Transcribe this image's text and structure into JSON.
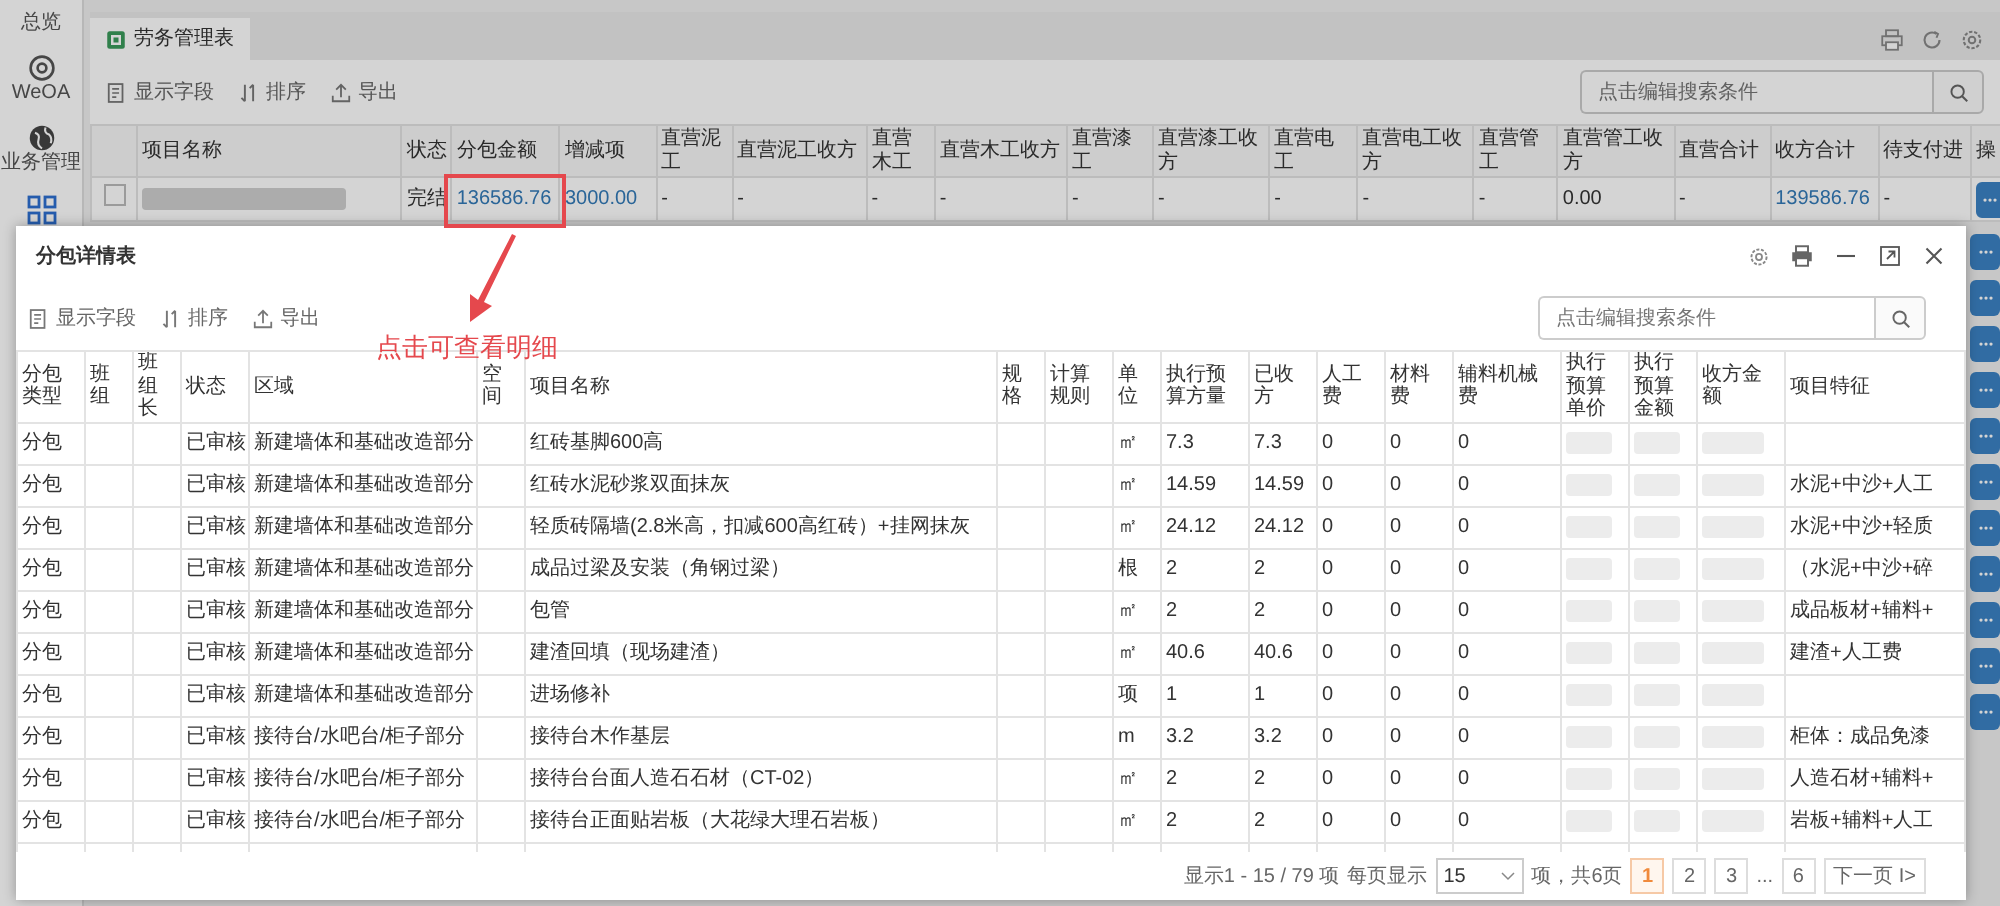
{
  "sidebar": {
    "items": [
      {
        "kind": "overview",
        "label": "总览"
      },
      {
        "kind": "target",
        "label": "WeOA"
      },
      {
        "kind": "globe",
        "label": "业务管理"
      },
      {
        "kind": "grid"
      }
    ]
  },
  "page_tab": {
    "label": "劳务管理表"
  },
  "toolbar": {
    "buttons": [
      {
        "kind": "fields",
        "label": "显示字段"
      },
      {
        "kind": "sort",
        "label": "排序"
      },
      {
        "kind": "export",
        "label": "导出"
      }
    ],
    "search": {
      "placeholder": "点击编辑搜索条件"
    }
  },
  "main_table": {
    "columns": [
      {
        "label": "项目名称",
        "kind": "redacted"
      },
      {
        "label": "状态",
        "kind": "text"
      },
      {
        "label": "分包金额",
        "kind": "link"
      },
      {
        "label": "增减项",
        "kind": "link"
      },
      {
        "label": "直营泥工",
        "kind": "text"
      },
      {
        "label": "直营泥工收方",
        "kind": "text"
      },
      {
        "label": "直营木工",
        "kind": "text"
      },
      {
        "label": "直营木工收方",
        "kind": "text"
      },
      {
        "label": "直营漆工",
        "kind": "text"
      },
      {
        "label": "直营漆工收方",
        "kind": "text"
      },
      {
        "label": "直营电工",
        "kind": "text"
      },
      {
        "label": "直营电工收方",
        "kind": "text"
      },
      {
        "label": "直营管工",
        "kind": "text"
      },
      {
        "label": "直营管工收方",
        "kind": "text"
      },
      {
        "label": "直营合计",
        "kind": "text"
      },
      {
        "label": "收方合计",
        "kind": "link"
      },
      {
        "label": "待支付进",
        "kind": "text"
      },
      {
        "label": "操",
        "kind": "action"
      }
    ],
    "rows": [
      {
        "checked": false,
        "values": [
          "完结",
          "136586.76",
          "3000.00",
          "-",
          "-",
          "-",
          "-",
          "-",
          "-",
          "-",
          "-",
          "-",
          "0.00",
          "-",
          "139586.76",
          "-"
        ]
      }
    ],
    "hidden_row_actions": [
      {
        "kind": "more"
      },
      {
        "kind": "more"
      },
      {
        "kind": "more"
      },
      {
        "kind": "more"
      },
      {
        "kind": "more"
      },
      {
        "kind": "more"
      },
      {
        "kind": "more"
      },
      {
        "kind": "more"
      },
      {
        "kind": "more"
      },
      {
        "kind": "more"
      },
      {
        "kind": "more"
      }
    ]
  },
  "annotation": {
    "text": "点击可查看明细"
  },
  "dialog": {
    "title": "分包详情表",
    "toolbar": {
      "buttons": [
        {
          "kind": "fields",
          "label": "显示字段"
        },
        {
          "kind": "sort",
          "label": "排序"
        },
        {
          "kind": "export",
          "label": "导出"
        }
      ],
      "search": {
        "placeholder": "点击编辑搜索条件"
      }
    },
    "columns": [
      "分包类型",
      "班组",
      "班组长",
      "状态",
      "区域",
      "空间",
      "项目名称",
      "规格",
      "计算规则",
      "单位",
      "执行预算方量",
      "已收方",
      "人工费",
      "材料费",
      "辅料机械费",
      "执行预算单价",
      "执行预算金额",
      "收方金额",
      "项目特征"
    ],
    "rows": [
      {
        "type": "分包",
        "status": "已审核",
        "area": "新建墙体和基础改造部分",
        "item_name": "红砖基脚600高",
        "unit": "㎡",
        "budget_quantity": "7.3",
        "received_quantity": "7.3",
        "labor_cost": "0",
        "material_cost": "0",
        "aux_machine_cost": "0"
      },
      {
        "type": "分包",
        "status": "已审核",
        "area": "新建墙体和基础改造部分",
        "item_name": "红砖水泥砂浆双面抹灰",
        "unit": "㎡",
        "budget_quantity": "14.59",
        "received_quantity": "14.59",
        "labor_cost": "0",
        "material_cost": "0",
        "aux_machine_cost": "0",
        "item_feature": "水泥+中沙+人工"
      },
      {
        "type": "分包",
        "status": "已审核",
        "area": "新建墙体和基础改造部分",
        "item_name": "轻质砖隔墙(2.8米高，扣减600高红砖）+挂网抹灰",
        "unit": "㎡",
        "budget_quantity": "24.12",
        "received_quantity": "24.12",
        "labor_cost": "0",
        "material_cost": "0",
        "aux_machine_cost": "0",
        "item_feature": "水泥+中沙+轻质"
      },
      {
        "type": "分包",
        "status": "已审核",
        "area": "新建墙体和基础改造部分",
        "item_name": "成品过梁及安装（角钢过梁）",
        "unit": "根",
        "budget_quantity": "2",
        "received_quantity": "2",
        "labor_cost": "0",
        "material_cost": "0",
        "aux_machine_cost": "0",
        "item_feature": "（水泥+中沙+碎"
      },
      {
        "type": "分包",
        "status": "已审核",
        "area": "新建墙体和基础改造部分",
        "item_name": "包管",
        "unit": "㎡",
        "budget_quantity": "2",
        "received_quantity": "2",
        "labor_cost": "0",
        "material_cost": "0",
        "aux_machine_cost": "0",
        "item_feature": "成品板材+辅料+"
      },
      {
        "type": "分包",
        "status": "已审核",
        "area": "新建墙体和基础改造部分",
        "item_name": "建渣回填（现场建渣）",
        "unit": "㎡",
        "budget_quantity": "40.6",
        "received_quantity": "40.6",
        "labor_cost": "0",
        "material_cost": "0",
        "aux_machine_cost": "0",
        "item_feature": "建渣+人工费"
      },
      {
        "type": "分包",
        "status": "已审核",
        "area": "新建墙体和基础改造部分",
        "item_name": "进场修补",
        "unit": "项",
        "budget_quantity": "1",
        "received_quantity": "1",
        "labor_cost": "0",
        "material_cost": "0",
        "aux_machine_cost": "0"
      },
      {
        "type": "分包",
        "status": "已审核",
        "area": "接待台/水吧台/柜子部分",
        "item_name": "接待台木作基层",
        "unit": "m",
        "budget_quantity": "3.2",
        "received_quantity": "3.2",
        "labor_cost": "0",
        "material_cost": "0",
        "aux_machine_cost": "0",
        "item_feature": "柜体：成品免漆"
      },
      {
        "type": "分包",
        "status": "已审核",
        "area": "接待台/水吧台/柜子部分",
        "item_name": "接待台台面人造石石材（CT-02）",
        "unit": "㎡",
        "budget_quantity": "2",
        "received_quantity": "2",
        "labor_cost": "0",
        "material_cost": "0",
        "aux_machine_cost": "0",
        "item_feature": "人造石材+辅料+"
      },
      {
        "type": "分包",
        "status": "已审核",
        "area": "接待台/水吧台/柜子部分",
        "item_name": "接待台正面贴岩板（大花绿大理石岩板）",
        "unit": "㎡",
        "budget_quantity": "2",
        "received_quantity": "2",
        "labor_cost": "0",
        "material_cost": "0",
        "aux_machine_cost": "0",
        "item_feature": "岩板+辅料+人工"
      }
    ],
    "pagination": {
      "summary": "显示1 - 15 / 79 项",
      "per_page_label": "每页显示",
      "per_page": "15",
      "total_label": "项，共6页",
      "pages": [
        {
          "kind": "page",
          "label": "1",
          "selected": true
        },
        {
          "kind": "page",
          "label": "2",
          "selected": false
        },
        {
          "kind": "page",
          "label": "3",
          "selected": false
        },
        {
          "kind": "ellipsis",
          "label": "..."
        },
        {
          "kind": "page",
          "label": "6",
          "selected": false
        }
      ],
      "next": "下一页 I>"
    }
  }
}
